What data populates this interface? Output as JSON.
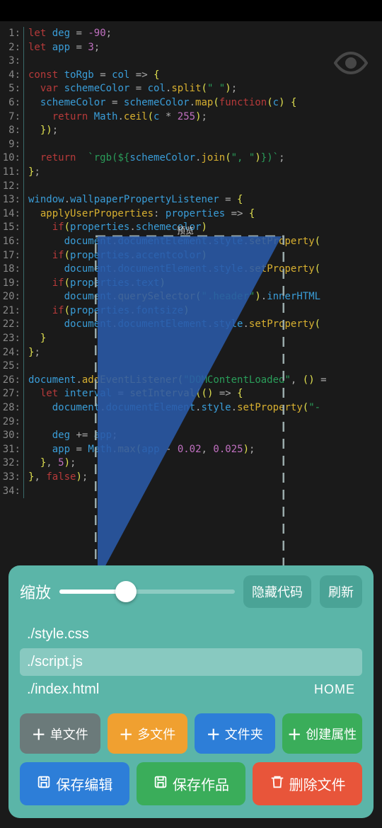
{
  "code": {
    "lines": [
      {
        "n": "1",
        "tokens": [
          [
            "kw",
            "let"
          ],
          [
            "",
            " "
          ],
          [
            "var",
            "deg"
          ],
          [
            "",
            " "
          ],
          [
            "op",
            "="
          ],
          [
            "",
            " "
          ],
          [
            "num",
            "-90"
          ],
          [
            "punc",
            ";"
          ]
        ]
      },
      {
        "n": "2",
        "tokens": [
          [
            "kw",
            "let"
          ],
          [
            "",
            " "
          ],
          [
            "var",
            "app"
          ],
          [
            "",
            " "
          ],
          [
            "op",
            "="
          ],
          [
            "",
            " "
          ],
          [
            "num",
            "3"
          ],
          [
            "punc",
            ";"
          ]
        ]
      },
      {
        "n": "3",
        "tokens": []
      },
      {
        "n": "4",
        "tokens": [
          [
            "kw",
            "const"
          ],
          [
            "",
            " "
          ],
          [
            "var",
            "toRgb"
          ],
          [
            "",
            " "
          ],
          [
            "op",
            "="
          ],
          [
            "",
            " "
          ],
          [
            "var",
            "col"
          ],
          [
            "",
            " "
          ],
          [
            "op",
            "=>"
          ],
          [
            "",
            " "
          ],
          [
            "paren",
            "{"
          ]
        ]
      },
      {
        "n": "5",
        "tokens": [
          [
            "",
            "  "
          ],
          [
            "kw",
            "var"
          ],
          [
            "",
            " "
          ],
          [
            "var",
            "schemeColor"
          ],
          [
            "",
            " "
          ],
          [
            "op",
            "="
          ],
          [
            "",
            " "
          ],
          [
            "var",
            "col"
          ],
          [
            "punc",
            "."
          ],
          [
            "fn",
            "split"
          ],
          [
            "paren",
            "("
          ],
          [
            "str",
            "\" \""
          ],
          [
            "paren",
            ")"
          ],
          [
            "punc",
            ";"
          ]
        ]
      },
      {
        "n": "6",
        "tokens": [
          [
            "",
            "  "
          ],
          [
            "var",
            "schemeColor"
          ],
          [
            "",
            " "
          ],
          [
            "op",
            "="
          ],
          [
            "",
            " "
          ],
          [
            "var",
            "schemeColor"
          ],
          [
            "punc",
            "."
          ],
          [
            "fn",
            "map"
          ],
          [
            "paren",
            "("
          ],
          [
            "kw",
            "function"
          ],
          [
            "paren",
            "("
          ],
          [
            "var",
            "c"
          ],
          [
            "paren",
            ")"
          ],
          [
            "",
            " "
          ],
          [
            "paren",
            "{"
          ]
        ]
      },
      {
        "n": "7",
        "tokens": [
          [
            "",
            "    "
          ],
          [
            "kw",
            "return"
          ],
          [
            "",
            " "
          ],
          [
            "var",
            "Math"
          ],
          [
            "punc",
            "."
          ],
          [
            "fn",
            "ceil"
          ],
          [
            "paren",
            "("
          ],
          [
            "var",
            "c"
          ],
          [
            "",
            " "
          ],
          [
            "op",
            "*"
          ],
          [
            "",
            " "
          ],
          [
            "num",
            "255"
          ],
          [
            "paren",
            ")"
          ],
          [
            "punc",
            ";"
          ]
        ]
      },
      {
        "n": "8",
        "tokens": [
          [
            "",
            "  "
          ],
          [
            "paren",
            "}"
          ],
          [
            "paren",
            ")"
          ],
          [
            "punc",
            ";"
          ]
        ]
      },
      {
        "n": "9",
        "tokens": []
      },
      {
        "n": "10",
        "tokens": [
          [
            "",
            "  "
          ],
          [
            "kw",
            "return"
          ],
          [
            "",
            "  "
          ],
          [
            "str",
            "`rgb(${"
          ],
          [
            "var",
            "schemeColor"
          ],
          [
            "punc",
            "."
          ],
          [
            "fn",
            "join"
          ],
          [
            "paren",
            "("
          ],
          [
            "str",
            "\", \""
          ],
          [
            "paren",
            ")"
          ],
          [
            "str",
            "})`"
          ],
          [
            "punc",
            ";"
          ]
        ]
      },
      {
        "n": "11",
        "tokens": [
          [
            "paren",
            "}"
          ],
          [
            "punc",
            ";"
          ]
        ]
      },
      {
        "n": "12",
        "tokens": []
      },
      {
        "n": "13",
        "tokens": [
          [
            "var",
            "window"
          ],
          [
            "punc",
            "."
          ],
          [
            "var",
            "wallpaperPropertyListener"
          ],
          [
            "",
            " "
          ],
          [
            "op",
            "="
          ],
          [
            "",
            " "
          ],
          [
            "paren",
            "{"
          ]
        ]
      },
      {
        "n": "14",
        "tokens": [
          [
            "",
            "  "
          ],
          [
            "fn",
            "applyUserProperties"
          ],
          [
            "punc",
            ":"
          ],
          [
            "",
            " "
          ],
          [
            "var",
            "properties"
          ],
          [
            "",
            " "
          ],
          [
            "op",
            "=>"
          ],
          [
            "",
            " "
          ],
          [
            "paren",
            "{"
          ]
        ]
      },
      {
        "n": "15",
        "tokens": [
          [
            "",
            "    "
          ],
          [
            "kw",
            "if"
          ],
          [
            "paren",
            "("
          ],
          [
            "var",
            "properties"
          ],
          [
            "punc",
            "."
          ],
          [
            "var",
            "schemecolor"
          ],
          [
            "paren",
            ")"
          ]
        ]
      },
      {
        "n": "16",
        "tokens": [
          [
            "",
            "      "
          ],
          [
            "var",
            "document"
          ],
          [
            "punc",
            "."
          ],
          [
            "var",
            "documentElement"
          ],
          [
            "punc",
            "."
          ],
          [
            "var",
            "style"
          ],
          [
            "punc",
            "."
          ],
          [
            "fn",
            "setProperty"
          ],
          [
            "paren",
            "("
          ]
        ]
      },
      {
        "n": "17",
        "tokens": [
          [
            "",
            "    "
          ],
          [
            "kw",
            "if"
          ],
          [
            "paren",
            "("
          ],
          [
            "var",
            "properties"
          ],
          [
            "punc",
            "."
          ],
          [
            "var",
            "accentcolor"
          ],
          [
            "paren",
            ")"
          ]
        ]
      },
      {
        "n": "18",
        "tokens": [
          [
            "",
            "      "
          ],
          [
            "var",
            "document"
          ],
          [
            "punc",
            "."
          ],
          [
            "var",
            "documentElement"
          ],
          [
            "punc",
            "."
          ],
          [
            "var",
            "style"
          ],
          [
            "punc",
            "."
          ],
          [
            "fn",
            "setProperty"
          ],
          [
            "paren",
            "("
          ]
        ]
      },
      {
        "n": "19",
        "tokens": [
          [
            "",
            "    "
          ],
          [
            "kw",
            "if"
          ],
          [
            "paren",
            "("
          ],
          [
            "var",
            "properties"
          ],
          [
            "punc",
            "."
          ],
          [
            "var",
            "text"
          ],
          [
            "paren",
            ")"
          ]
        ]
      },
      {
        "n": "20",
        "tokens": [
          [
            "",
            "      "
          ],
          [
            "var",
            "document"
          ],
          [
            "punc",
            "."
          ],
          [
            "fn",
            "querySelector"
          ],
          [
            "paren",
            "("
          ],
          [
            "str",
            "\".header\""
          ],
          [
            "paren",
            ")"
          ],
          [
            "punc",
            "."
          ],
          [
            "var",
            "innerHTML"
          ]
        ]
      },
      {
        "n": "21",
        "tokens": [
          [
            "",
            "    "
          ],
          [
            "kw",
            "if"
          ],
          [
            "paren",
            "("
          ],
          [
            "var",
            "properties"
          ],
          [
            "punc",
            "."
          ],
          [
            "var",
            "fontsize"
          ],
          [
            "paren",
            ")"
          ]
        ]
      },
      {
        "n": "22",
        "tokens": [
          [
            "",
            "      "
          ],
          [
            "var",
            "document"
          ],
          [
            "punc",
            "."
          ],
          [
            "var",
            "documentElement"
          ],
          [
            "punc",
            "."
          ],
          [
            "var",
            "style"
          ],
          [
            "punc",
            "."
          ],
          [
            "fn",
            "setProperty"
          ],
          [
            "paren",
            "("
          ]
        ]
      },
      {
        "n": "23",
        "tokens": [
          [
            "",
            "  "
          ],
          [
            "paren",
            "}"
          ]
        ]
      },
      {
        "n": "24",
        "tokens": [
          [
            "paren",
            "}"
          ],
          [
            "punc",
            ";"
          ]
        ]
      },
      {
        "n": "25",
        "tokens": []
      },
      {
        "n": "26",
        "tokens": [
          [
            "var",
            "document"
          ],
          [
            "punc",
            "."
          ],
          [
            "fn",
            "addEventListener"
          ],
          [
            "paren",
            "("
          ],
          [
            "str",
            "\"DOMContentLoaded\""
          ],
          [
            "punc",
            ","
          ],
          [
            "",
            " "
          ],
          [
            "paren",
            "("
          ],
          [
            "paren",
            ")"
          ],
          [
            "",
            " "
          ],
          [
            "op",
            "="
          ]
        ]
      },
      {
        "n": "27",
        "tokens": [
          [
            "",
            "  "
          ],
          [
            "kw",
            "let"
          ],
          [
            "",
            " "
          ],
          [
            "var",
            "interval"
          ],
          [
            "",
            " "
          ],
          [
            "op",
            "="
          ],
          [
            "",
            " "
          ],
          [
            "fn",
            "setInterval"
          ],
          [
            "paren",
            "("
          ],
          [
            "paren",
            "("
          ],
          [
            "paren",
            ")"
          ],
          [
            "",
            " "
          ],
          [
            "op",
            "=>"
          ],
          [
            "",
            " "
          ],
          [
            "paren",
            "{"
          ]
        ]
      },
      {
        "n": "28",
        "tokens": [
          [
            "",
            "    "
          ],
          [
            "var",
            "document"
          ],
          [
            "punc",
            "."
          ],
          [
            "var",
            "documentElement"
          ],
          [
            "punc",
            "."
          ],
          [
            "var",
            "style"
          ],
          [
            "punc",
            "."
          ],
          [
            "fn",
            "setProperty"
          ],
          [
            "paren",
            "("
          ],
          [
            "str",
            "\"-"
          ]
        ]
      },
      {
        "n": "29",
        "tokens": []
      },
      {
        "n": "30",
        "tokens": [
          [
            "",
            "    "
          ],
          [
            "var",
            "deg"
          ],
          [
            "",
            " "
          ],
          [
            "op",
            "+="
          ],
          [
            "",
            " "
          ],
          [
            "var",
            "app"
          ],
          [
            "punc",
            ";"
          ]
        ]
      },
      {
        "n": "31",
        "tokens": [
          [
            "",
            "    "
          ],
          [
            "var",
            "app"
          ],
          [
            "",
            " "
          ],
          [
            "op",
            "="
          ],
          [
            "",
            " "
          ],
          [
            "var",
            "Math"
          ],
          [
            "punc",
            "."
          ],
          [
            "fn",
            "max"
          ],
          [
            "paren",
            "("
          ],
          [
            "var",
            "app"
          ],
          [
            "",
            " "
          ],
          [
            "op",
            "-"
          ],
          [
            "",
            " "
          ],
          [
            "num",
            "0.02"
          ],
          [
            "punc",
            ","
          ],
          [
            "",
            " "
          ],
          [
            "num",
            "0.025"
          ],
          [
            "paren",
            ")"
          ],
          [
            "punc",
            ";"
          ]
        ]
      },
      {
        "n": "32",
        "tokens": [
          [
            "",
            "  "
          ],
          [
            "paren",
            "}"
          ],
          [
            "punc",
            ","
          ],
          [
            "",
            " "
          ],
          [
            "num",
            "5"
          ],
          [
            "paren",
            ")"
          ],
          [
            "punc",
            ";"
          ]
        ]
      },
      {
        "n": "33",
        "tokens": [
          [
            "paren",
            "}"
          ],
          [
            "punc",
            ","
          ],
          [
            "",
            " "
          ],
          [
            "kw",
            "false"
          ],
          [
            "paren",
            ")"
          ],
          [
            "punc",
            ";"
          ]
        ]
      },
      {
        "n": "34",
        "tokens": []
      }
    ]
  },
  "toolbar": {
    "zoom_label": "缩放",
    "hide_code": "隐藏代码",
    "refresh": "刷新",
    "files": [
      {
        "name": "./style.css",
        "selected": false
      },
      {
        "name": "./script.js",
        "selected": true
      },
      {
        "name": "./index.html",
        "selected": false,
        "home": "HOME"
      }
    ],
    "buttons_row1": [
      {
        "label": "单文件",
        "class": "btn-gray",
        "icon": "＋"
      },
      {
        "label": "多文件",
        "class": "btn-orange",
        "icon": "＋"
      },
      {
        "label": "文件夹",
        "class": "btn-blue",
        "icon": "＋"
      },
      {
        "label": "创建属性",
        "class": "btn-green",
        "icon": "＋"
      }
    ],
    "buttons_row2": [
      {
        "label": "保存编辑",
        "class": "btn-blue",
        "icon": "save"
      },
      {
        "label": "保存作品",
        "class": "btn-green",
        "icon": "save"
      },
      {
        "label": "删除文件",
        "class": "btn-red",
        "icon": "trash"
      }
    ]
  },
  "slider": {
    "value": 38
  }
}
